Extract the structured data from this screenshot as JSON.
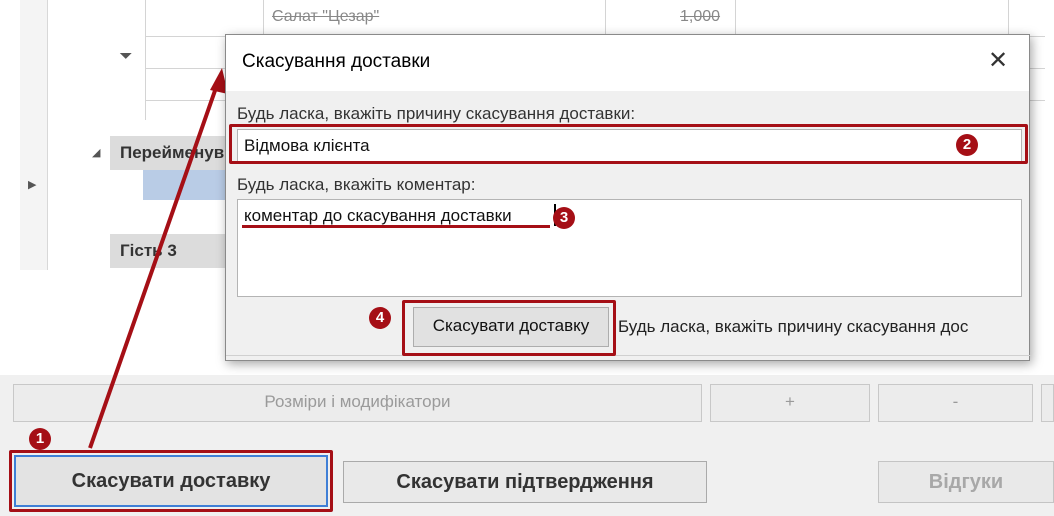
{
  "grid": {
    "item_name": "Салат \"Цезар\"",
    "item_qty": "1,000",
    "group_rename": "Перейменув",
    "group_guest": "Гість 3"
  },
  "strip": {
    "sizes_label": "Розміри і модифікатори",
    "plus_label": "+",
    "minus_label": "-"
  },
  "bottom": {
    "cancel_delivery_label": "Скасувати доставку",
    "cancel_confirm_label": "Скасувати підтвердження",
    "reviews_label": "Відгуки"
  },
  "dialog": {
    "title": "Скасування доставки",
    "close_glyph": "✕",
    "reason_label": "Будь ласка, вкажіть причину скасування доставки:",
    "reason_value": "Відмова клієнта",
    "comment_label": "Будь ласка, вкажіть коментар:",
    "comment_value": "коментар до скасування доставки",
    "submit_label": "Скасувати доставку",
    "hint_text": "Будь ласка, вкажіть причину скасування дос"
  },
  "annotations": {
    "n1": "1",
    "n2": "2",
    "n3": "3",
    "n4": "4",
    "color": "#a50f16"
  }
}
